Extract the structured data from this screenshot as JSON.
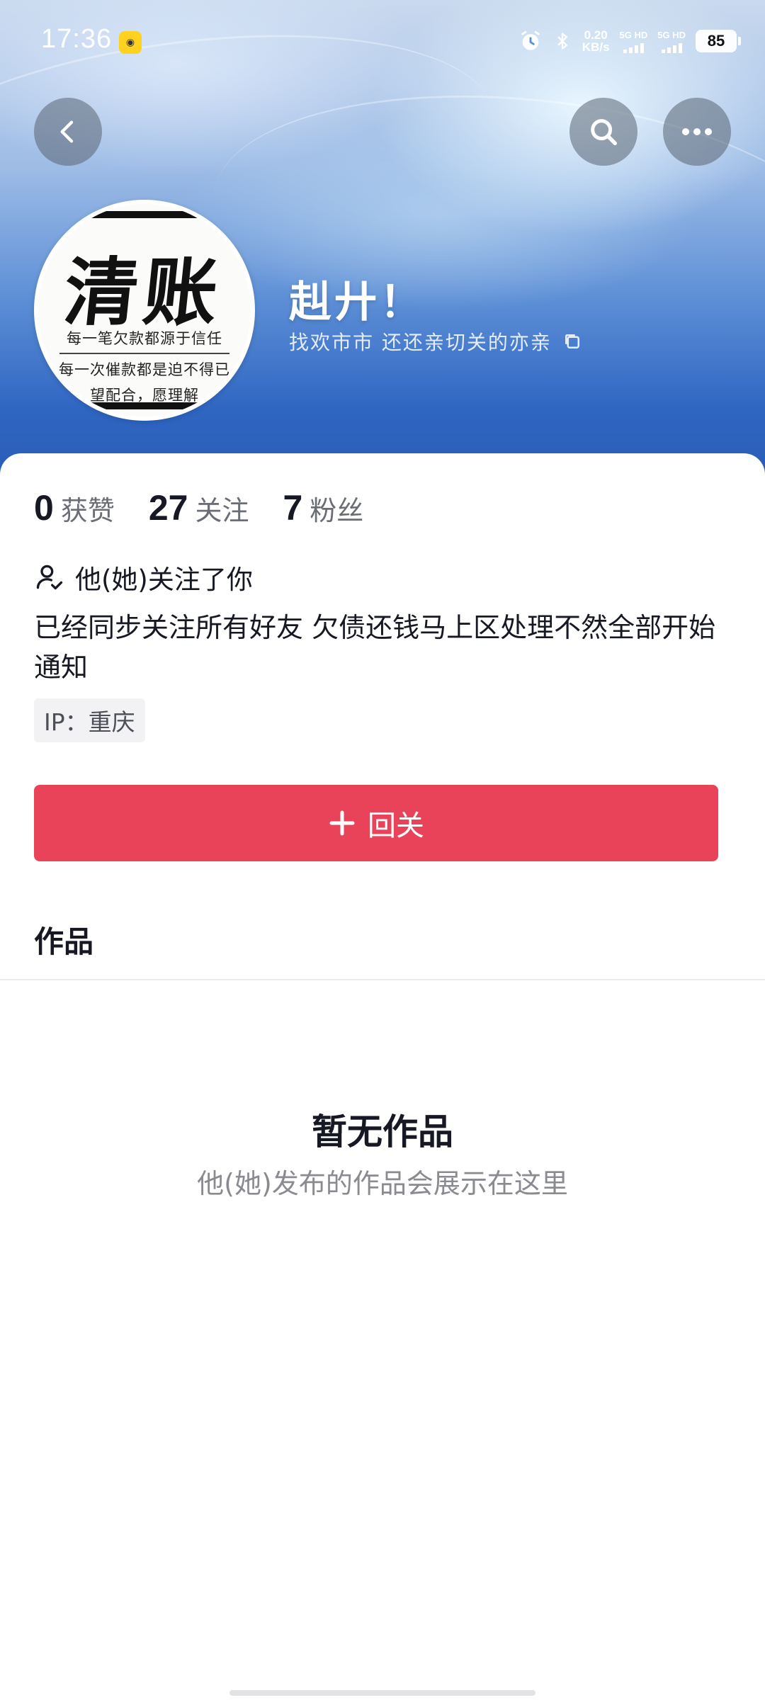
{
  "status_bar": {
    "time": "17:36",
    "net_speed_value": "0.20",
    "net_speed_unit": "KB/s",
    "sim1_label": "5G HD",
    "sim2_label": "5G HD",
    "battery": "85"
  },
  "header": {
    "back_icon": "chevron-left-icon",
    "search_icon": "search-icon",
    "more_icon": "more-horizontal-icon"
  },
  "avatar": {
    "big_text": "清账",
    "line1": "每一笔欠款都源于信任",
    "line2": "每一次催款都是迫不得已",
    "line3": "望配合，愿理解"
  },
  "profile": {
    "nickname": "赳廾！",
    "sub_line": "找欢市市  还还亲切关的亦亲",
    "stats": [
      {
        "value": "0",
        "label": "获赞"
      },
      {
        "value": "27",
        "label": "关注"
      },
      {
        "value": "7",
        "label": "粉丝"
      }
    ],
    "follow_note": "他(她)关注了你",
    "bio": "已经同步关注所有好友 欠债还钱马上区处理不然全部开始通知",
    "ip": "IP：重庆",
    "follow_back_label": "回关"
  },
  "works": {
    "tab_label": "作品",
    "empty_title": "暂无作品",
    "empty_subtitle": "他(她)发布的作品会展示在这里"
  },
  "colors": {
    "accent": "#e94359",
    "banner_top": "#c9d9ee",
    "banner_bottom": "#2a5cb6"
  }
}
